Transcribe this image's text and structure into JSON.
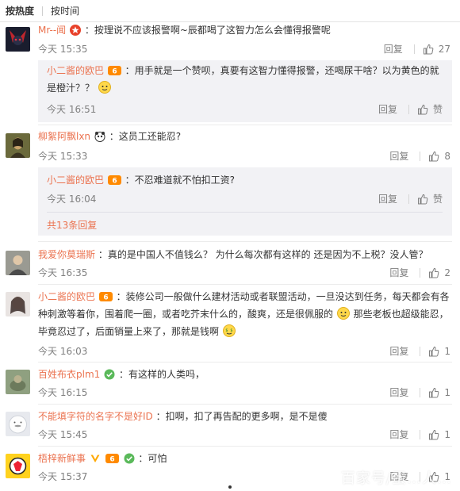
{
  "tabs": [
    {
      "label": "按热度"
    },
    {
      "label": "按时间"
    }
  ],
  "comments": [
    {
      "user": "Mr--闻",
      "text": "：按理说不应该报警啊~辰都喝了这智力怎么会懂得报警呢",
      "time": "今天 15:35",
      "reply_label": "回复",
      "likes": "27",
      "reply": {
        "user": "小二酱的欧巴",
        "text_line1": "：用手就是一个赞呗，真要有这智力懂得报警，还喝尿干啥？以为黄色的就",
        "text_line2": "是橙汁？？",
        "time": "今天 16:51",
        "reply_label": "回复",
        "like_label": "赞"
      }
    },
    {
      "user": "柳絮阿飘lxn",
      "text": "：这员工还能忍?",
      "time": "今天 15:33",
      "reply_label": "回复",
      "likes": "8",
      "reply": {
        "user": "小二酱的欧巴",
        "text_line1": "：不忍难道就不怕扣工资?",
        "time": "今天 16:04",
        "reply_label": "回复",
        "like_label": "赞",
        "more": "共13条回复"
      }
    },
    {
      "user": "我爱你莫瑞斯",
      "text": "：真的是中国人不值钱么？ 为什么每次都有这样的 还是因为不上税？没人管？",
      "time": "今天 16:35",
      "reply_label": "回复",
      "likes": "2"
    },
    {
      "user": "小二酱的欧巴",
      "text_line1": "：装修公司一般做什么建材活动或者联盟活动，一旦没达到任务，每天都会有各",
      "text_line2a": "种刺激等着你，围着爬一圈，或者吃芥末什么的，酸爽，还是很佩服的",
      "text_line2b": "那些老板也超级能忍，",
      "text_line3": "毕竟忍过了，后面销量上来了，那就是钱啊",
      "time": "今天 16:03",
      "reply_label": "回复",
      "likes": "1"
    },
    {
      "user": "百姓布衣plm1",
      "text": "：有这样的人类吗，",
      "time": "今天 16:15",
      "reply_label": "回复",
      "likes": "1"
    },
    {
      "user": "不能填字符的名字不是好ID",
      "text": "：扣啊，扣了再告配的更多啊，是不是傻",
      "time": "今天 15:45",
      "reply_label": "回复",
      "likes": "1"
    },
    {
      "user": "梧梓新鲜事",
      "text": "：可怕",
      "time": "今天 15:37",
      "reply_label": "回复",
      "likes": "1"
    }
  ],
  "watermark": "百家号/蛋…人…",
  "colors": {
    "username": "#eb7350",
    "meta": "#808080",
    "reply_bg": "#f2f2f5",
    "text": "#333333"
  }
}
